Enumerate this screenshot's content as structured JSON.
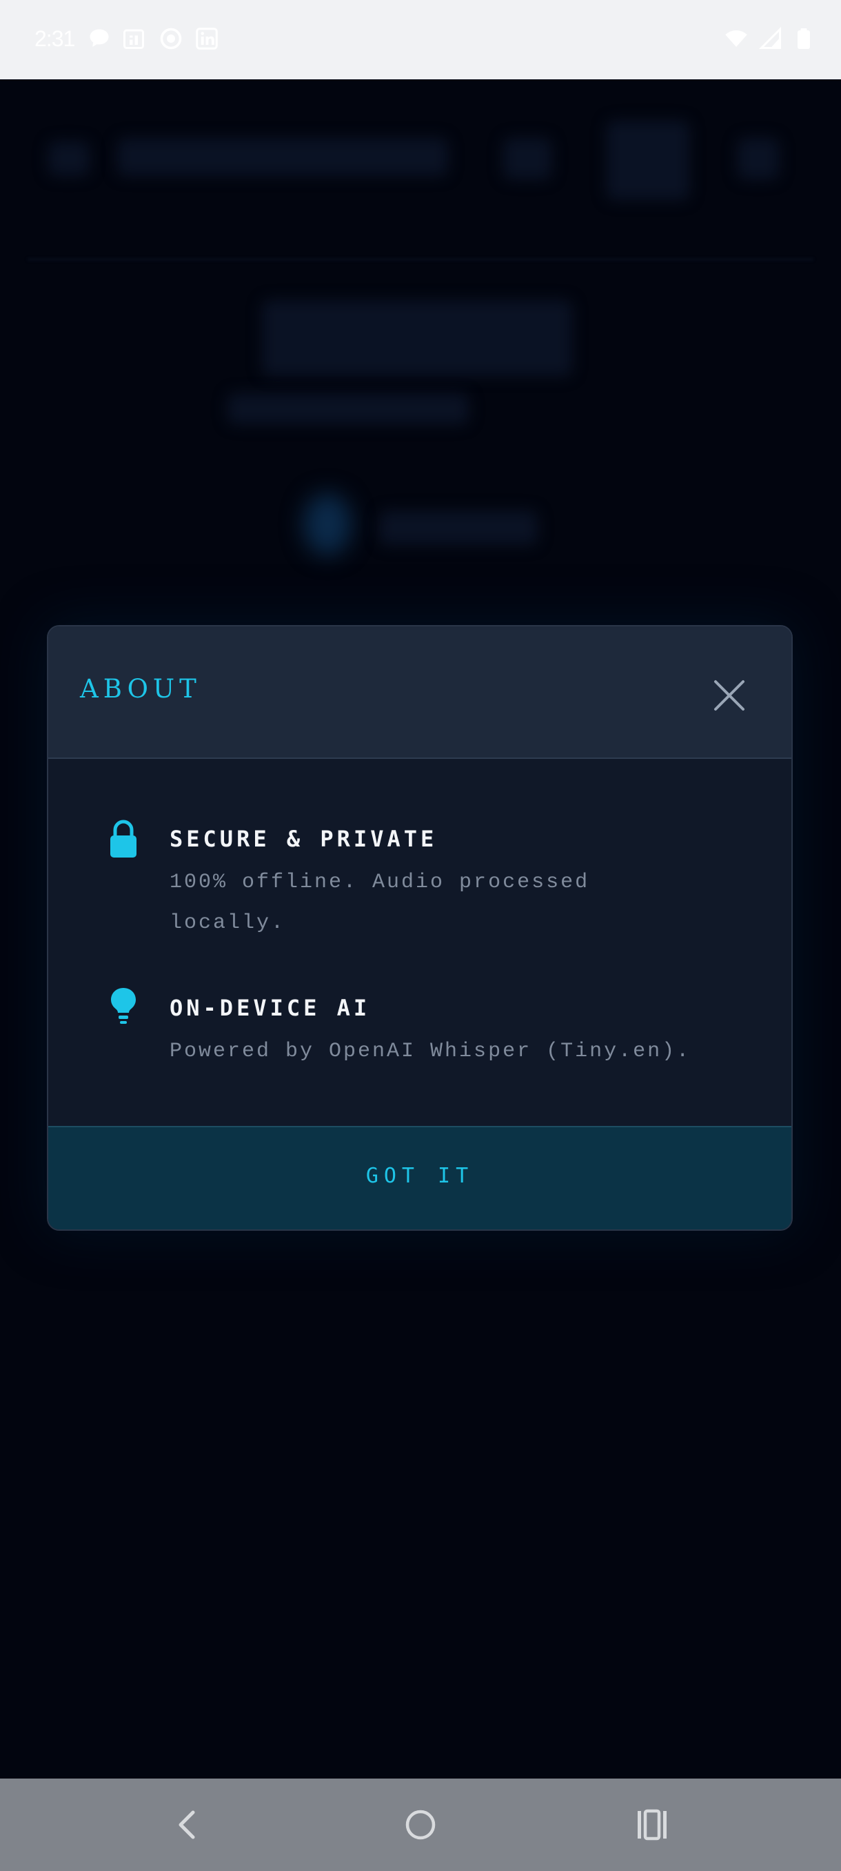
{
  "status_bar": {
    "time": "2:31",
    "left_icons": [
      "message-icon",
      "calendar-icon",
      "record-icon",
      "linkedin-icon"
    ],
    "right_icons": [
      "wifi-icon",
      "signal-icon",
      "battery-icon"
    ]
  },
  "dialog": {
    "title": "ABOUT",
    "features": [
      {
        "icon": "lock-icon",
        "title": "SECURE & PRIVATE",
        "description": "100% offline. Audio processed locally."
      },
      {
        "icon": "lightbulb-icon",
        "title": "ON-DEVICE AI",
        "description": "Powered by OpenAI Whisper (Tiny.en)."
      }
    ],
    "confirm_label": "GOT IT"
  },
  "colors": {
    "accent": "#1ec5e8",
    "background": "#02050f",
    "dialog_header": "#1e293b",
    "dialog_body": "#101828",
    "dialog_footer": "#0b3346",
    "text_primary": "#f3f5f8",
    "text_secondary": "#808b9c",
    "nav_bar": "#80848b"
  },
  "nav_bar": {
    "icons": [
      "back-icon",
      "home-icon",
      "recents-icon"
    ]
  }
}
